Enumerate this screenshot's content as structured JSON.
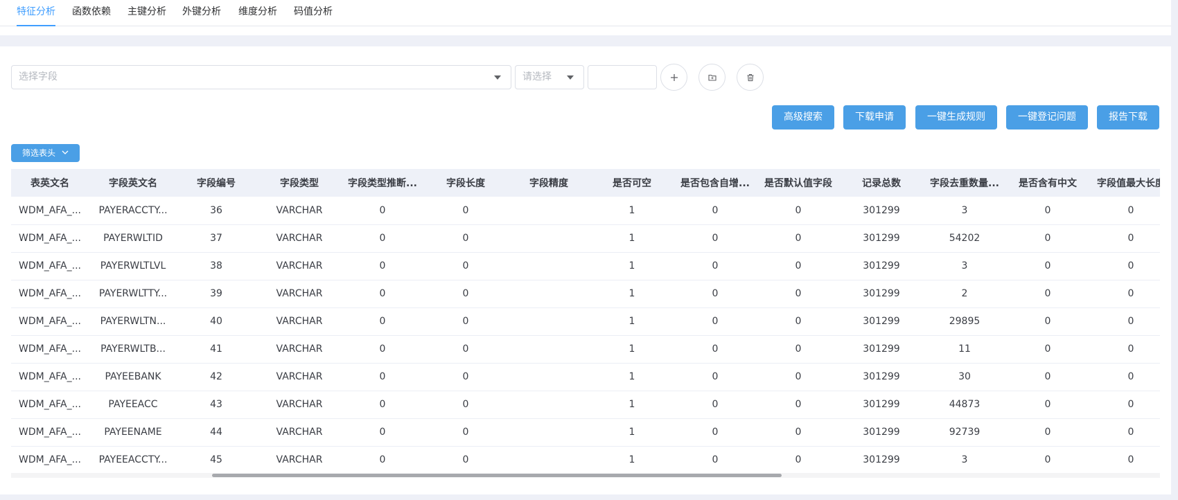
{
  "tabs": [
    {
      "label": "特征分析",
      "active": true
    },
    {
      "label": "函数依赖",
      "active": false
    },
    {
      "label": "主键分析",
      "active": false
    },
    {
      "label": "外键分析",
      "active": false
    },
    {
      "label": "维度分析",
      "active": false
    },
    {
      "label": "码值分析",
      "active": false
    }
  ],
  "filters": {
    "field_select_placeholder": "选择字段",
    "operator_select_placeholder": "请选择",
    "value_input": "",
    "add_icon": "plus-icon",
    "folder_icon": "folder-icon",
    "delete_icon": "trash-icon"
  },
  "actions": {
    "advanced_search": "高级搜索",
    "download_request": "下载申请",
    "generate_rules": "一键生成规则",
    "register_issue": "一键登记问题",
    "report_download": "报告下载"
  },
  "filter_header_button": "筛选表头",
  "colors": {
    "accent": "#409eff",
    "button": "#4a9fe6",
    "header_bg": "#eef1f8"
  },
  "table": {
    "columns": [
      "表英文名",
      "字段英文名",
      "字段编号",
      "字段类型",
      "字段类型推断...",
      "字段长度",
      "字段精度",
      "是否可空",
      "是否包含自增...",
      "是否默认值字段",
      "记录总数",
      "字段去重数量...",
      "是否含有中文",
      "字段值最大长度"
    ],
    "rows": [
      [
        "WDM_AFA_...",
        "PAYERACCTY...",
        "36",
        "VARCHAR",
        "0",
        "0",
        "",
        "1",
        "0",
        "0",
        "301299",
        "3",
        "0",
        "0"
      ],
      [
        "WDM_AFA_...",
        "PAYERWLTID",
        "37",
        "VARCHAR",
        "0",
        "0",
        "",
        "1",
        "0",
        "0",
        "301299",
        "54202",
        "0",
        "0"
      ],
      [
        "WDM_AFA_...",
        "PAYERWLTLVL",
        "38",
        "VARCHAR",
        "0",
        "0",
        "",
        "1",
        "0",
        "0",
        "301299",
        "3",
        "0",
        "0"
      ],
      [
        "WDM_AFA_...",
        "PAYERWLTTY...",
        "39",
        "VARCHAR",
        "0",
        "0",
        "",
        "1",
        "0",
        "0",
        "301299",
        "2",
        "0",
        "0"
      ],
      [
        "WDM_AFA_...",
        "PAYERWLTN...",
        "40",
        "VARCHAR",
        "0",
        "0",
        "",
        "1",
        "0",
        "0",
        "301299",
        "29895",
        "0",
        "0"
      ],
      [
        "WDM_AFA_...",
        "PAYERWLTB...",
        "41",
        "VARCHAR",
        "0",
        "0",
        "",
        "1",
        "0",
        "0",
        "301299",
        "11",
        "0",
        "0"
      ],
      [
        "WDM_AFA_...",
        "PAYEEBANK",
        "42",
        "VARCHAR",
        "0",
        "0",
        "",
        "1",
        "0",
        "0",
        "301299",
        "30",
        "0",
        "0"
      ],
      [
        "WDM_AFA_...",
        "PAYEEACC",
        "43",
        "VARCHAR",
        "0",
        "0",
        "",
        "1",
        "0",
        "0",
        "301299",
        "44873",
        "0",
        "0"
      ],
      [
        "WDM_AFA_...",
        "PAYEENAME",
        "44",
        "VARCHAR",
        "0",
        "0",
        "",
        "1",
        "0",
        "0",
        "301299",
        "92739",
        "0",
        "0"
      ],
      [
        "WDM_AFA_...",
        "PAYEEACCTY...",
        "45",
        "VARCHAR",
        "0",
        "0",
        "",
        "1",
        "0",
        "0",
        "301299",
        "3",
        "0",
        "0"
      ]
    ]
  }
}
